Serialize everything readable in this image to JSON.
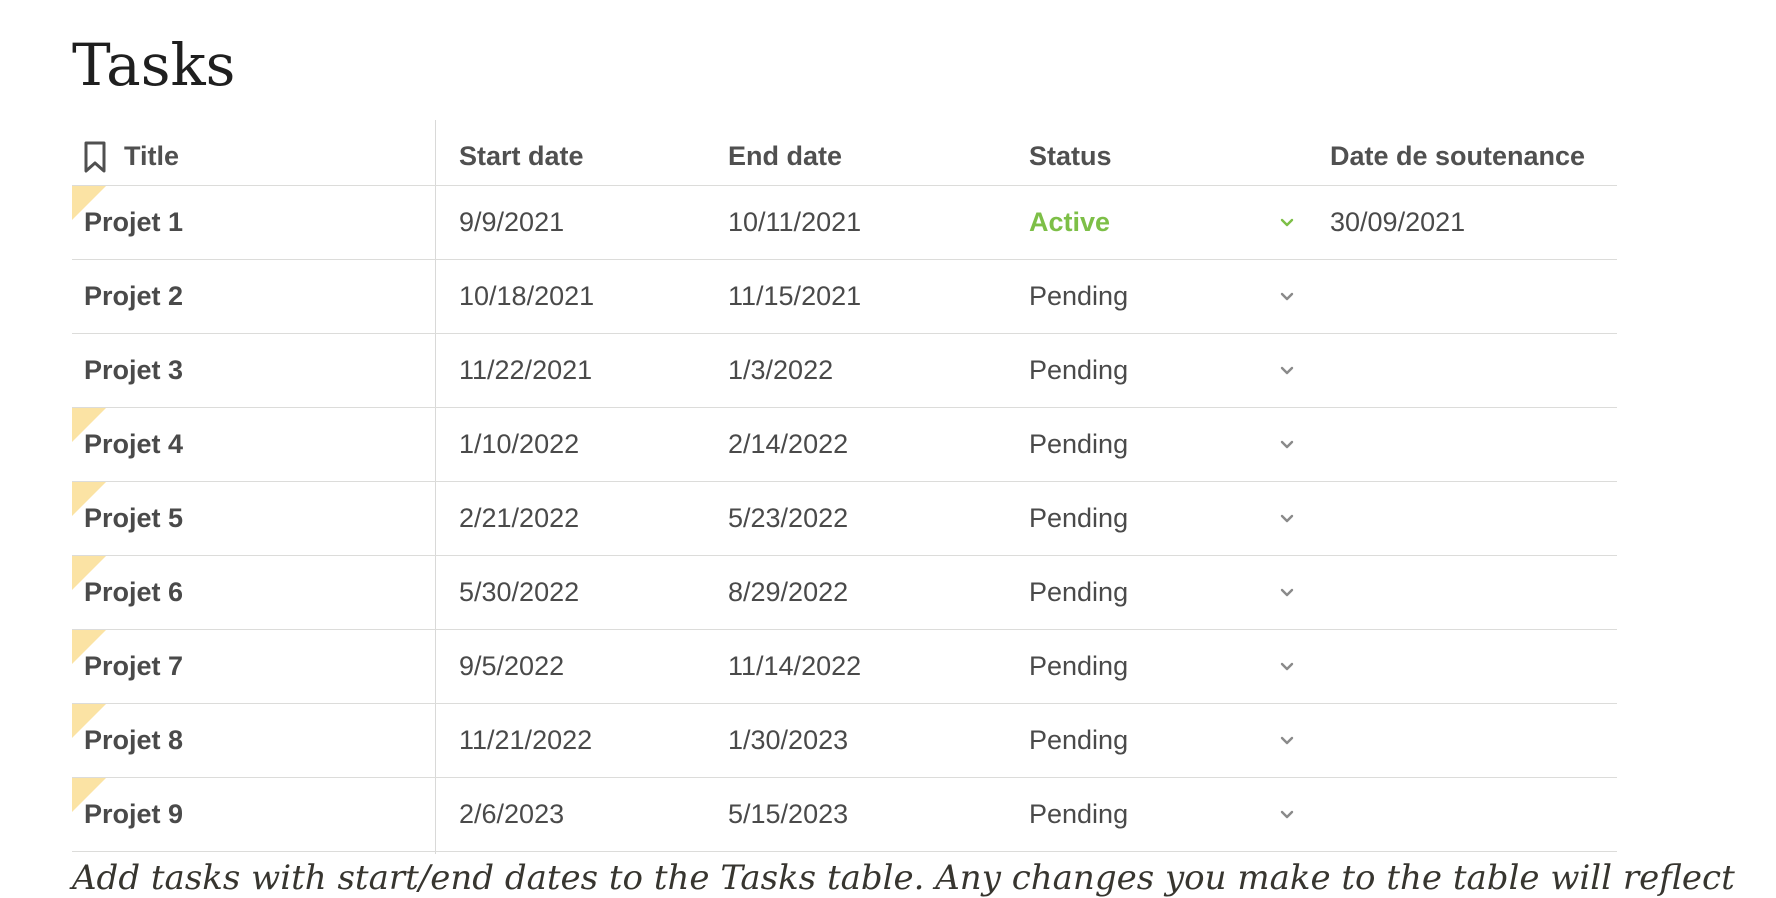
{
  "page": {
    "title": "Tasks",
    "footer_text": "Add tasks with start/end dates to the Tasks table. Any changes you make to the table will reflect"
  },
  "table": {
    "columns": {
      "title": "Title",
      "start_date": "Start date",
      "end_date": "End date",
      "status": "Status",
      "defense_date": "Date de soutenance"
    },
    "rows": [
      {
        "title": "Projet 1",
        "start_date": "9/9/2021",
        "end_date": "10/11/2021",
        "status": "Active",
        "defense_date": "30/09/2021",
        "flag": true
      },
      {
        "title": "Projet 2",
        "start_date": "10/18/2021",
        "end_date": "11/15/2021",
        "status": "Pending",
        "defense_date": "",
        "flag": false
      },
      {
        "title": "Projet 3",
        "start_date": "11/22/2021",
        "end_date": "1/3/2022",
        "status": "Pending",
        "defense_date": "",
        "flag": false
      },
      {
        "title": "Projet 4",
        "start_date": "1/10/2022",
        "end_date": "2/14/2022",
        "status": "Pending",
        "defense_date": "",
        "flag": true
      },
      {
        "title": "Projet 5",
        "start_date": "2/21/2022",
        "end_date": "5/23/2022",
        "status": "Pending",
        "defense_date": "",
        "flag": true
      },
      {
        "title": "Projet 6",
        "start_date": "5/30/2022",
        "end_date": "8/29/2022",
        "status": "Pending",
        "defense_date": "",
        "flag": true
      },
      {
        "title": "Projet 7",
        "start_date": "9/5/2022",
        "end_date": "11/14/2022",
        "status": "Pending",
        "defense_date": "",
        "flag": true
      },
      {
        "title": "Projet 8",
        "start_date": "11/21/2022",
        "end_date": "1/30/2023",
        "status": "Pending",
        "defense_date": "",
        "flag": true
      },
      {
        "title": "Projet 9",
        "start_date": "2/6/2023",
        "end_date": "5/15/2023",
        "status": "Pending",
        "defense_date": "",
        "flag": true
      }
    ]
  },
  "colors": {
    "active_status": "#7dbf47",
    "row_flag": "#fbe3a4",
    "divider": "#dcdcda"
  },
  "icons": {
    "title_column": "bookmark-icon",
    "status_dropdown": "chevron-down-icon"
  }
}
